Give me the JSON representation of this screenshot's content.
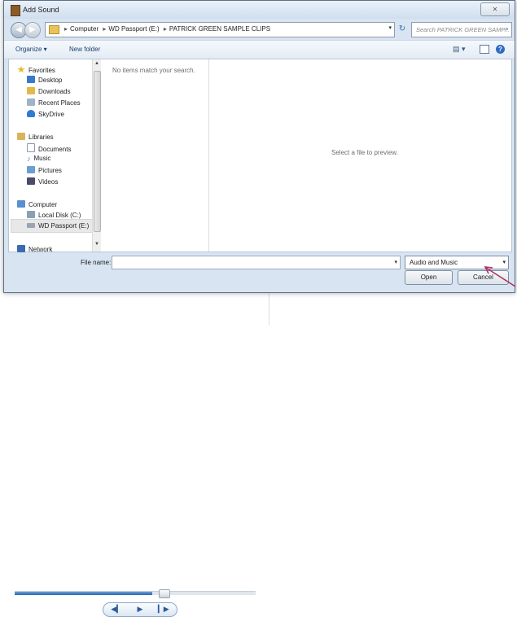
{
  "dialog": {
    "title": "Add Sound",
    "close_glyph": "✕"
  },
  "nav": {
    "back_glyph": "◀",
    "forward_glyph": "▶",
    "breadcrumbs": [
      "Computer",
      "WD Passport (E:)",
      "PATRICK GREEN SAMPLE CLIPS"
    ],
    "breadcrumb_separator": "▸",
    "address_dropdown_glyph": "▾",
    "refresh_glyph": "↻",
    "search_placeholder": "Search PATRICK GREEN SAMP...",
    "search_glyph": "⌕"
  },
  "toolbar": {
    "organize_label": "Organize ▾",
    "new_folder_label": "New folder",
    "views_glyph": "▤ ▾",
    "help_glyph": "?"
  },
  "sidebar": {
    "items": [
      {
        "label": "Favorites",
        "icon": "star-icon",
        "color": "#e8b923"
      },
      {
        "label": "Desktop",
        "icon": "desktop-icon",
        "color": "#3a78c8"
      },
      {
        "label": "Downloads",
        "icon": "downloads-icon",
        "color": "#e5b84a"
      },
      {
        "label": "Recent Places",
        "icon": "recent-places-icon",
        "color": "#9fb3c8"
      },
      {
        "label": "SkyDrive",
        "icon": "skydrive-icon",
        "color": "#2e7bd6"
      },
      {
        "label": "Libraries",
        "icon": "libraries-icon",
        "color": "#d9b45a"
      },
      {
        "label": "Documents",
        "icon": "documents-icon",
        "color": "#c9d4e0"
      },
      {
        "label": "Music",
        "icon": "music-icon",
        "color": "#3a78c8"
      },
      {
        "label": "Pictures",
        "icon": "pictures-icon",
        "color": "#6a9fd0"
      },
      {
        "label": "Videos",
        "icon": "videos-icon",
        "color": "#4a4a6a"
      },
      {
        "label": "Computer",
        "icon": "computer-icon",
        "color": "#5a8fd0"
      },
      {
        "label": "Local Disk (C:)",
        "icon": "local-disk-icon",
        "color": "#8aa0b5"
      },
      {
        "label": "WD Passport (E:)",
        "icon": "external-drive-icon",
        "color": "#9aa5b1"
      },
      {
        "label": "Network",
        "icon": "network-icon",
        "color": "#3a6bb0"
      }
    ]
  },
  "content": {
    "empty_message": "No items match your search.",
    "preview_message": "Select a file to preview."
  },
  "footer": {
    "file_name_label": "File name:",
    "file_name_value": "",
    "file_type_selected": "Audio and Music",
    "dropdown_glyph": "▾",
    "open_label": "Open",
    "cancel_label": "Cancel"
  },
  "player": {
    "prev_glyph": "◀▎",
    "play_glyph": "▶",
    "next_glyph": "▎▶",
    "progress_fraction": 0.57
  },
  "colors": {
    "annotation_arrow": "#b03060"
  }
}
